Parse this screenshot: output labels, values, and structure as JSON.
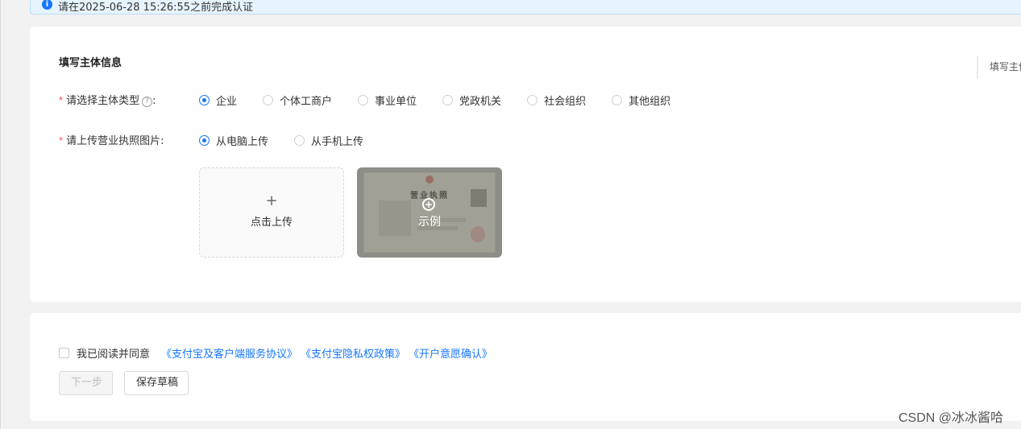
{
  "alert": {
    "text": "请在2025-06-28 15:26:55之前完成认证",
    "icon": "info-icon"
  },
  "form": {
    "title": "填写主体信息",
    "side_anchor": "填写主体",
    "subject_type": {
      "label": "请选择主体类型",
      "suffix": ":",
      "required_mark": "*",
      "help": "?",
      "options": [
        "企业",
        "个体工商户",
        "事业单位",
        "党政机关",
        "社会组织",
        "其他组织"
      ],
      "selected": "企业"
    },
    "license_upload": {
      "label": "请上传营业执照图片:",
      "required_mark": "*",
      "options": [
        "从电脑上传",
        "从手机上传"
      ],
      "selected": "从电脑上传"
    },
    "upload": {
      "plus": "+",
      "label": "点击上传"
    },
    "example": {
      "doc_title": "营业执照",
      "label": "示例"
    }
  },
  "agreement": {
    "text": "我已阅读并同意",
    "links": [
      "《支付宝及客户端服务协议》",
      "《支付宝隐私权政策》",
      "《开户意愿确认》"
    ],
    "checked": false
  },
  "actions": {
    "next_label": "下一步",
    "next_disabled": true,
    "draft_label": "保存草稿"
  },
  "watermark": "CSDN @冰冰酱哈",
  "colors": {
    "accent": "#1677ff",
    "required": "#ff4d4f",
    "alert_bg": "#e6f4ff"
  }
}
